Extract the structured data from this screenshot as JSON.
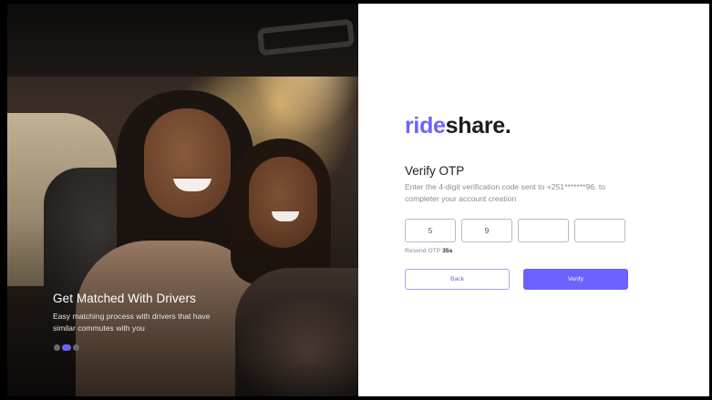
{
  "onboarding": {
    "title": "Get Matched With Drivers",
    "description": "Easy matching process with drivers that have similar commutes with you",
    "carousel": {
      "slides": 3,
      "active_index": 1
    }
  },
  "brand": {
    "part1": "ride",
    "part2": "share.",
    "accent_color": "#6c63ff"
  },
  "verify": {
    "title": "Verify OTP",
    "description": "Enter the 4-digit verification code sent to +251*******96. to completer your account creation",
    "digits": [
      "5",
      "9",
      "",
      ""
    ],
    "resend_label": "Resend OTP",
    "resend_timer": "35s"
  },
  "actions": {
    "back_label": "Back",
    "verify_label": "Verify"
  }
}
